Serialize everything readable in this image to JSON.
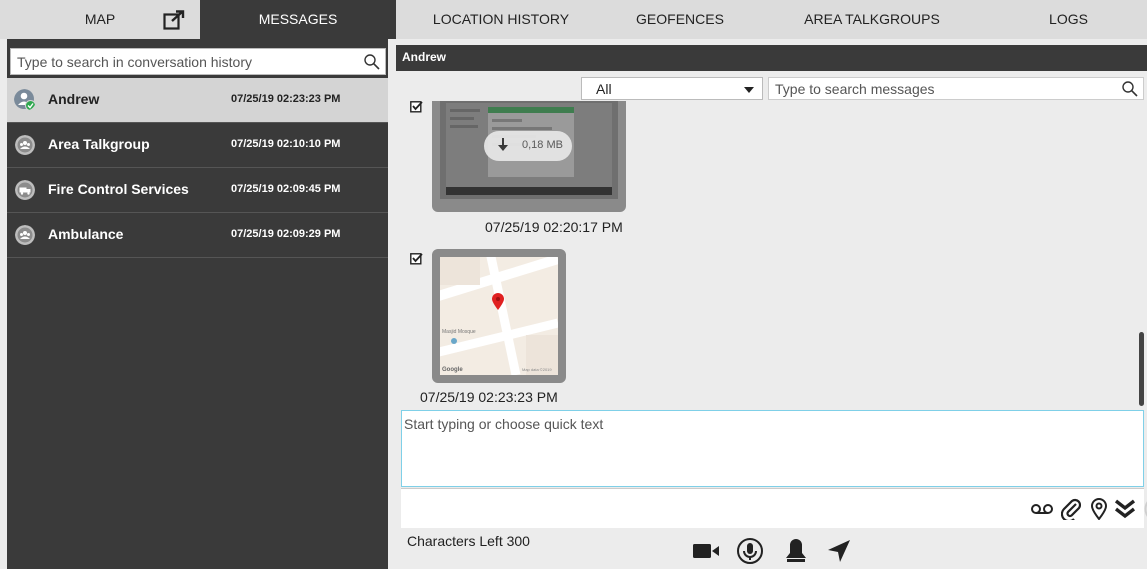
{
  "tabs": [
    {
      "label": "MAP"
    },
    {
      "label": "MESSAGES"
    },
    {
      "label": "LOCATION HISTORY"
    },
    {
      "label": "GEOFENCES"
    },
    {
      "label": "AREA TALKGROUPS"
    },
    {
      "label": "LOGS"
    }
  ],
  "left": {
    "search_placeholder": "Type to search in conversation history",
    "conversations": [
      {
        "name": "Andrew",
        "time": "07/25/19 02:23:23 PM",
        "icon": "user-online-icon"
      },
      {
        "name": "Area Talkgroup",
        "time": "07/25/19 02:10:10 PM",
        "icon": "talkgroup-icon"
      },
      {
        "name": "Fire Control Services",
        "time": "07/25/19 02:09:45 PM",
        "icon": "fire-truck-icon"
      },
      {
        "name": "Ambulance",
        "time": "07/25/19 02:09:29 PM",
        "icon": "ambulance-icon"
      }
    ]
  },
  "chat": {
    "contact": "Andrew",
    "filter_value": "All",
    "search_placeholder": "Type to search messages",
    "messages": [
      {
        "type": "file",
        "size": "0,18 MB",
        "time": "07/25/19 02:20:17 PM"
      },
      {
        "type": "location",
        "time": "07/25/19 02:23:23 PM"
      }
    ],
    "composer_placeholder": "Start typing or choose quick text",
    "characters_left": "Characters Left 300"
  },
  "colors": {
    "dark": "#3a3a3a",
    "active_row": "#d4d4d4",
    "online": "#2fa84f",
    "pin": "#e02020"
  }
}
